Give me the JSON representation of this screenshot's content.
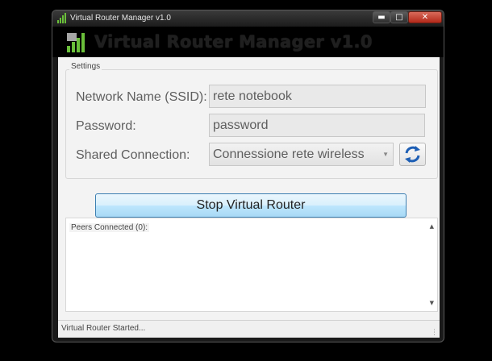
{
  "window": {
    "title": "Virtual Router Manager v1.0",
    "app_icon": "signal-bars-icon",
    "controls": {
      "minimize": "minimize-icon",
      "maximize": "maximize-icon",
      "close": "close-icon"
    }
  },
  "header": {
    "title": "Virtual Router Manager v1.0"
  },
  "settings": {
    "legend": "Settings",
    "network_name_label": "Network Name (SSID):",
    "network_name_value": "rete notebook",
    "password_label": "Password:",
    "password_value": "password",
    "shared_connection_label": "Shared Connection:",
    "shared_connection_value": "Connessione rete wireless",
    "refresh_icon": "refresh-icon"
  },
  "actions": {
    "main_button_label": "Stop Virtual Router"
  },
  "peers": {
    "label": "Peers Connected (0):",
    "count": 0
  },
  "status": {
    "text": "Virtual Router Started..."
  },
  "colors": {
    "accent_button": "#bee6fd",
    "icon_green": "#6abf3a"
  }
}
